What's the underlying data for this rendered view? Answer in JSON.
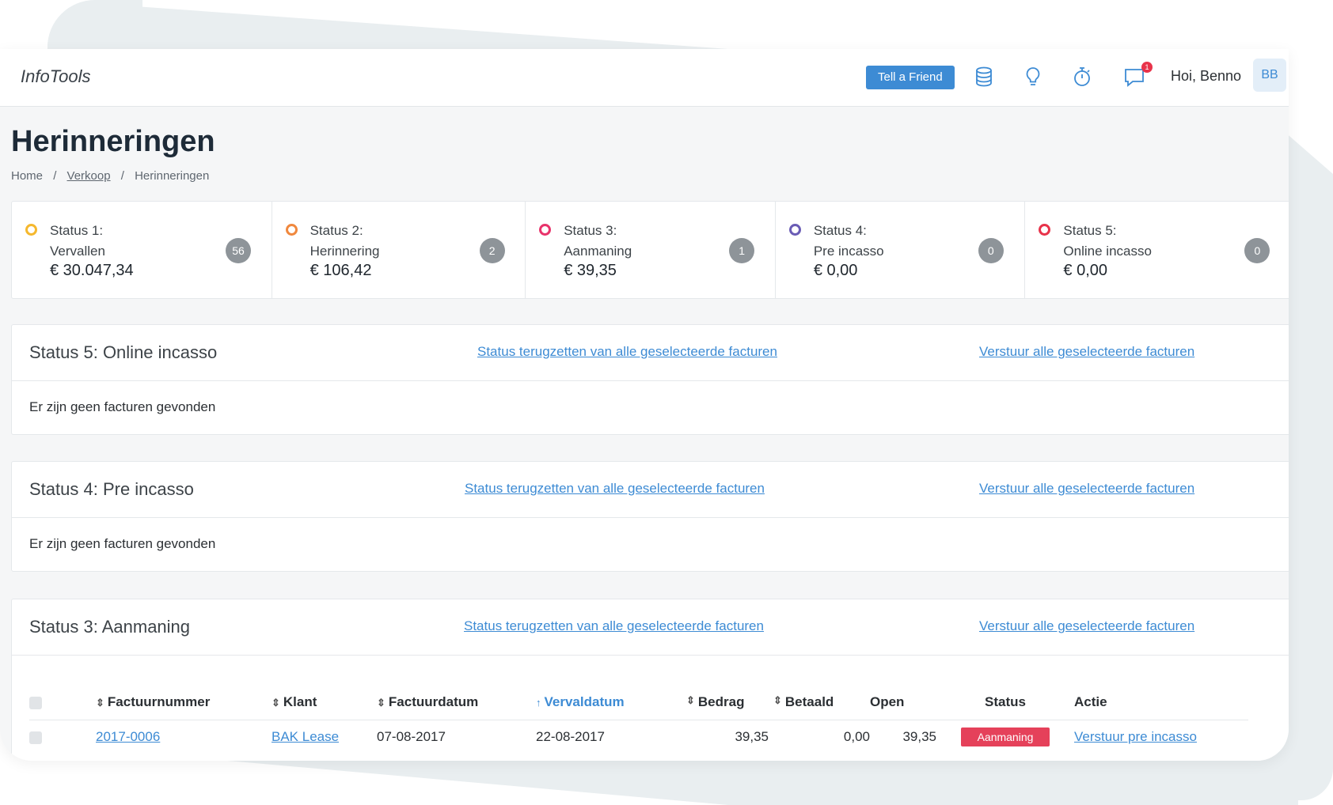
{
  "app": {
    "brand": "InfoTools",
    "tell_a_friend": "Tell a Friend",
    "greeting": "Hoi, Benno",
    "avatar_initials": "BB",
    "notification_count": "1"
  },
  "header": {
    "icons": [
      "database-icon",
      "lightbulb-icon",
      "stopwatch-icon",
      "chat-icon"
    ]
  },
  "page": {
    "title": "Herinneringen"
  },
  "breadcrumb": {
    "home": "Home",
    "sep": "/",
    "verkoop": "Verkoop",
    "current": "Herinneringen"
  },
  "statuses": [
    {
      "label": "Status 1:",
      "name": "Vervallen",
      "amount": "€ 30.047,34",
      "count": "56",
      "color": "#f5b82e"
    },
    {
      "label": "Status 2:",
      "name": "Herinnering",
      "amount": "€ 106,42",
      "count": "2",
      "color": "#f0883e"
    },
    {
      "label": "Status 3:",
      "name": "Aanmaning",
      "amount": "€ 39,35",
      "count": "1",
      "color": "#e8336b"
    },
    {
      "label": "Status 4:",
      "name": "Pre incasso",
      "amount": "€ 0,00",
      "count": "0",
      "color": "#6a5cb5"
    },
    {
      "label": "Status 5:",
      "name": "Online incasso",
      "amount": "€ 0,00",
      "count": "0",
      "color": "#e8334a"
    }
  ],
  "panels": {
    "reset_link": "Status terugzetten van alle geselecteerde facturen",
    "send_link": "Verstuur alle geselecteerde facturen",
    "empty_text": "Er zijn geen facturen gevonden",
    "status5_title": "Status 5: Online incasso",
    "status4_title": "Status 4: Pre incasso",
    "status3_title": "Status 3: Aanmaning"
  },
  "table": {
    "headers": {
      "factuurnummer": "Factuurnummer",
      "klant": "Klant",
      "factuurdatum": "Factuurdatum",
      "vervaldatum": "Vervaldatum",
      "bedrag": "Bedrag",
      "betaald": "Betaald",
      "open": "Open",
      "status": "Status",
      "actie": "Actie"
    },
    "rows": [
      {
        "factuurnummer": "2017-0006",
        "klant": "BAK Lease",
        "factuurdatum": "07-08-2017",
        "vervaldatum": "22-08-2017",
        "bedrag": "39,35",
        "betaald": "0,00",
        "open": "39,35",
        "status": "Aanmaning",
        "actie": "Verstuur pre incasso"
      }
    ]
  }
}
